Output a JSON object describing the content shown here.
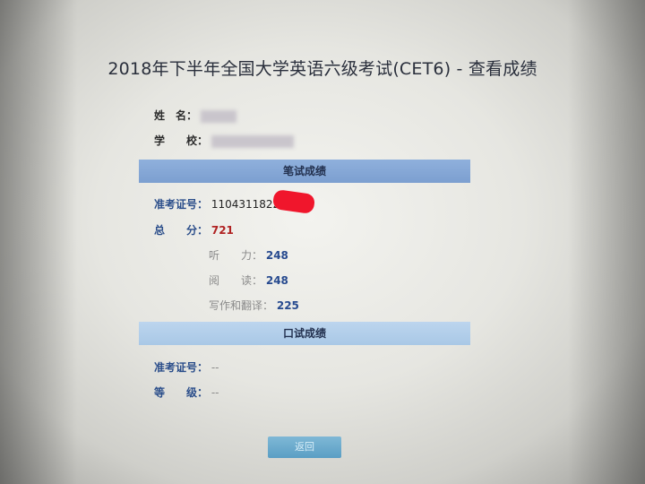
{
  "page": {
    "title": "2018年下半年全国大学英语六级考试(CET6) - 查看成绩"
  },
  "student": {
    "name_label": "姓　名：",
    "school_label": "学　　校："
  },
  "written": {
    "header": "笔试成绩",
    "ticket_label": "准考证号：",
    "ticket_value": "11043118220",
    "total_label": "总　　分：",
    "total_value": "721",
    "subs": [
      {
        "label": "听　　力：",
        "value": "248"
      },
      {
        "label": "阅　　读：",
        "value": "248"
      },
      {
        "label": "写作和翻译：",
        "value": "225"
      }
    ]
  },
  "oral": {
    "header": "口试成绩",
    "ticket_label": "准考证号：",
    "ticket_value": "--",
    "grade_label": "等　　级：",
    "grade_value": "--"
  },
  "actions": {
    "back_label": "返回"
  }
}
